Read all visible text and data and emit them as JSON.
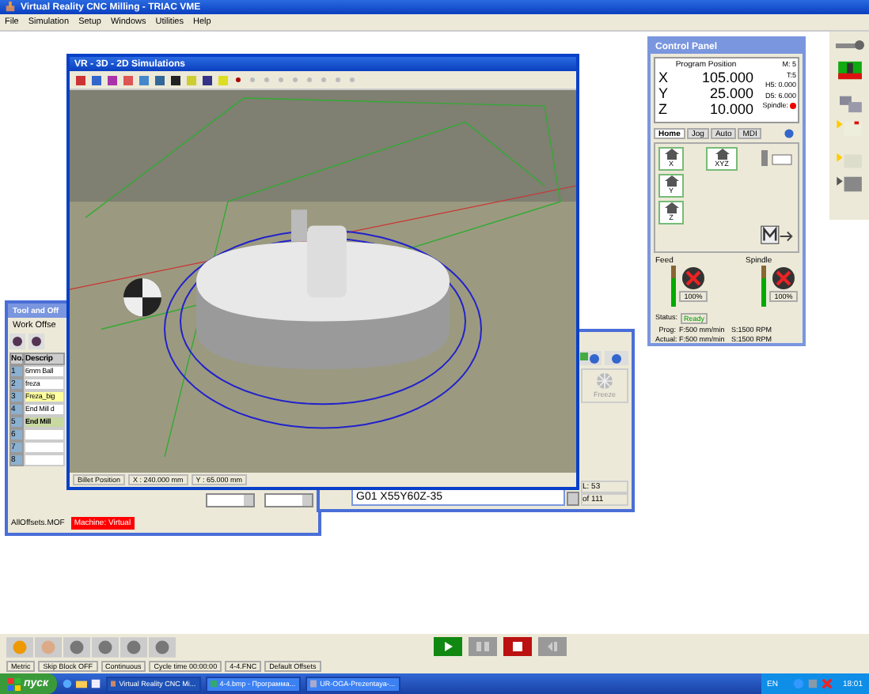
{
  "window": {
    "title": "Virtual Reality CNC Milling  -  TRIAC VME"
  },
  "menu": [
    "File",
    "Simulation",
    "Setup",
    "Windows",
    "Utilities",
    "Help"
  ],
  "simulation_window": {
    "title": "VR - 3D - 2D Simulations",
    "status": [
      "Billet Position",
      "X : 240.000 mm",
      "Y : 65.000 mm"
    ]
  },
  "control_panel": {
    "title": "Control Panel",
    "position_label": "Program Position",
    "axes": [
      {
        "axis": "X",
        "value": "105.000"
      },
      {
        "axis": "Y",
        "value": "25.000"
      },
      {
        "axis": "Z",
        "value": "10.000"
      }
    ],
    "info": [
      "M: 5",
      "T:5",
      "H5: 0.000",
      "D5: 6.000"
    ],
    "spindle_label": "Spindle:",
    "spindle_on": false,
    "tabs": [
      {
        "label": "Home",
        "selected": true
      },
      {
        "label": "Jog",
        "selected": false
      },
      {
        "label": "Auto",
        "selected": false
      },
      {
        "label": "MDI",
        "selected": false
      }
    ],
    "home_buttons": [
      "X",
      "Y",
      "Z",
      "XYZ"
    ],
    "meters": [
      {
        "label": "Feed",
        "level": 0.7,
        "reading": "100%"
      },
      {
        "label": "Spindle",
        "level": 0.7,
        "reading": "100%"
      }
    ],
    "status_label": "Status:",
    "status": "Ready",
    "prog": {
      "label": "Prog:",
      "feed": "F:500 mm/min",
      "speed": "S:1500 RPM"
    },
    "actual": {
      "label": "Actual:",
      "feed": "F:500 mm/min",
      "speed": "S:1500 RPM"
    }
  },
  "tool_window": {
    "title": "Tool and Off",
    "tab": "Work Offse",
    "columns": [
      "No.",
      "Descrip"
    ],
    "rows": [
      {
        "no": "1",
        "description": "6mm Ball",
        "selected": false,
        "highlighted": false
      },
      {
        "no": "2",
        "description": "freza",
        "selected": false,
        "highlighted": false
      },
      {
        "no": "3",
        "description": "Freza_big",
        "selected": false,
        "highlighted": true
      },
      {
        "no": "4",
        "description": "End Mill d",
        "selected": false,
        "highlighted": false
      },
      {
        "no": "5",
        "description": "End Mill",
        "selected": true,
        "highlighted": false
      },
      {
        "no": "6",
        "selected": false,
        "highlighted": false
      },
      {
        "no": "7",
        "selected": false,
        "highlighted": false
      },
      {
        "no": "8",
        "selected": false,
        "highlighted": false
      }
    ],
    "footer": [
      "AllOffsets.MOF",
      "Machine: Virtual"
    ]
  },
  "program_window": {
    "freeze": "Freeze",
    "line": "G01 X55Y60Z-35",
    "line_number": "L: 53",
    "total": "of 111"
  },
  "status_bar": [
    "Metric",
    "Skip Block OFF",
    "Continuous",
    "Cycle time 00:00:00",
    "4-4.FNC",
    "Default Offsets"
  ],
  "taskbar": {
    "start": "пуск",
    "tasks": [
      {
        "label": "Virtual Reality CNC Mi...",
        "selected": true
      },
      {
        "label": "4-4.bmp - Программа...",
        "selected": false
      },
      {
        "label": "UR-OGA-Prezentaya-...",
        "selected": false
      }
    ],
    "language": "EN",
    "clock": "18:01"
  }
}
